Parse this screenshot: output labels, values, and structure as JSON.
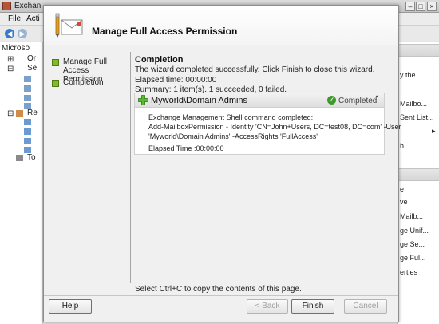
{
  "background_window": {
    "title": "Exchan",
    "menu": [
      "File",
      "Acti"
    ],
    "tree_items": [
      "Microso",
      "Or",
      "Se",
      "Re",
      "To"
    ],
    "actions_items": [
      "y the ...",
      "Mailbo...",
      "Sent List...",
      "h",
      "e",
      "ve",
      "Mailb...",
      "ge Unif...",
      "ge Se...",
      "ge Ful...",
      "erties"
    ]
  },
  "wizard": {
    "title": "Manage Full Access Permission",
    "steps": [
      {
        "label": "Manage Full Access Permission"
      },
      {
        "label": "Completion"
      }
    ],
    "completion": {
      "heading": "Completion",
      "message": "The wizard completed successfully. Click Finish to close this wizard.",
      "elapsed": "Elapsed time: 00:00:00",
      "summary": "Summary: 1 item(s). 1 succeeded, 0 failed."
    },
    "task": {
      "name": "Myworld\\Domain Admins",
      "status": "Completed",
      "body_lines": [
        "Exchange Management Shell command completed:",
        "Add-MailboxPermission - Identity 'CN=John+Users, DC=test08, DC=com' -User",
        "'Myworld\\Domain Admins' -AccessRights 'FullAccess'"
      ],
      "elapsed": "Elapsed Time :00:00:00"
    },
    "hint": "Select Ctrl+C to copy the contents of this page.",
    "buttons": {
      "help": "Help",
      "back": "< Back",
      "finish": "Finish",
      "cancel": "Cancel"
    }
  },
  "colors": {
    "accent_green": "#86b92a",
    "status_green": "#3e9a2a"
  }
}
